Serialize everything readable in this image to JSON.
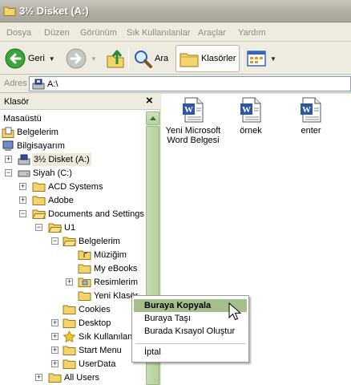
{
  "window": {
    "title": "3½ Disket (A:)"
  },
  "menu": [
    "Dosya",
    "Düzen",
    "Görünüm",
    "Sık Kullanılanlar",
    "Araçlar",
    "Yardım"
  ],
  "toolbar": {
    "back_label": "Geri",
    "search_label": "Ara",
    "folders_label": "Klasörler"
  },
  "address": {
    "label": "Adres",
    "value": "A:\\"
  },
  "folder_pane": {
    "title": "Klasör",
    "close": "×",
    "tree": [
      "Masaüstü",
      "Belgelerim",
      "Bilgisayarım",
      "3½ Disket (A:)",
      "Siyah (C:)",
      "ACD Systems",
      "Adobe",
      "Documents and Settings",
      "U1",
      "Belgelerim",
      "Müziğim",
      "My eBooks",
      "Resimlerim",
      "Yeni Klasör",
      "Cookies",
      "Desktop",
      "Sık Kullanılanlar",
      "Start Menu",
      "UserData",
      "All Users"
    ]
  },
  "files": [
    {
      "name": "Yeni Microsoft Word Belgesi",
      "icon": "word-document-icon"
    },
    {
      "name": "örnek",
      "icon": "word-document-icon"
    },
    {
      "name": "enter",
      "icon": "word-document-icon"
    }
  ],
  "context_menu": [
    "Buraya Kopyala",
    "Buraya Taşı",
    "Burada Kısayol Oluştur",
    "İptal"
  ],
  "colors": {
    "highlight": "#A4BE8C",
    "chrome": "#ECE9D8",
    "scrollbar": "#B3D09A"
  }
}
